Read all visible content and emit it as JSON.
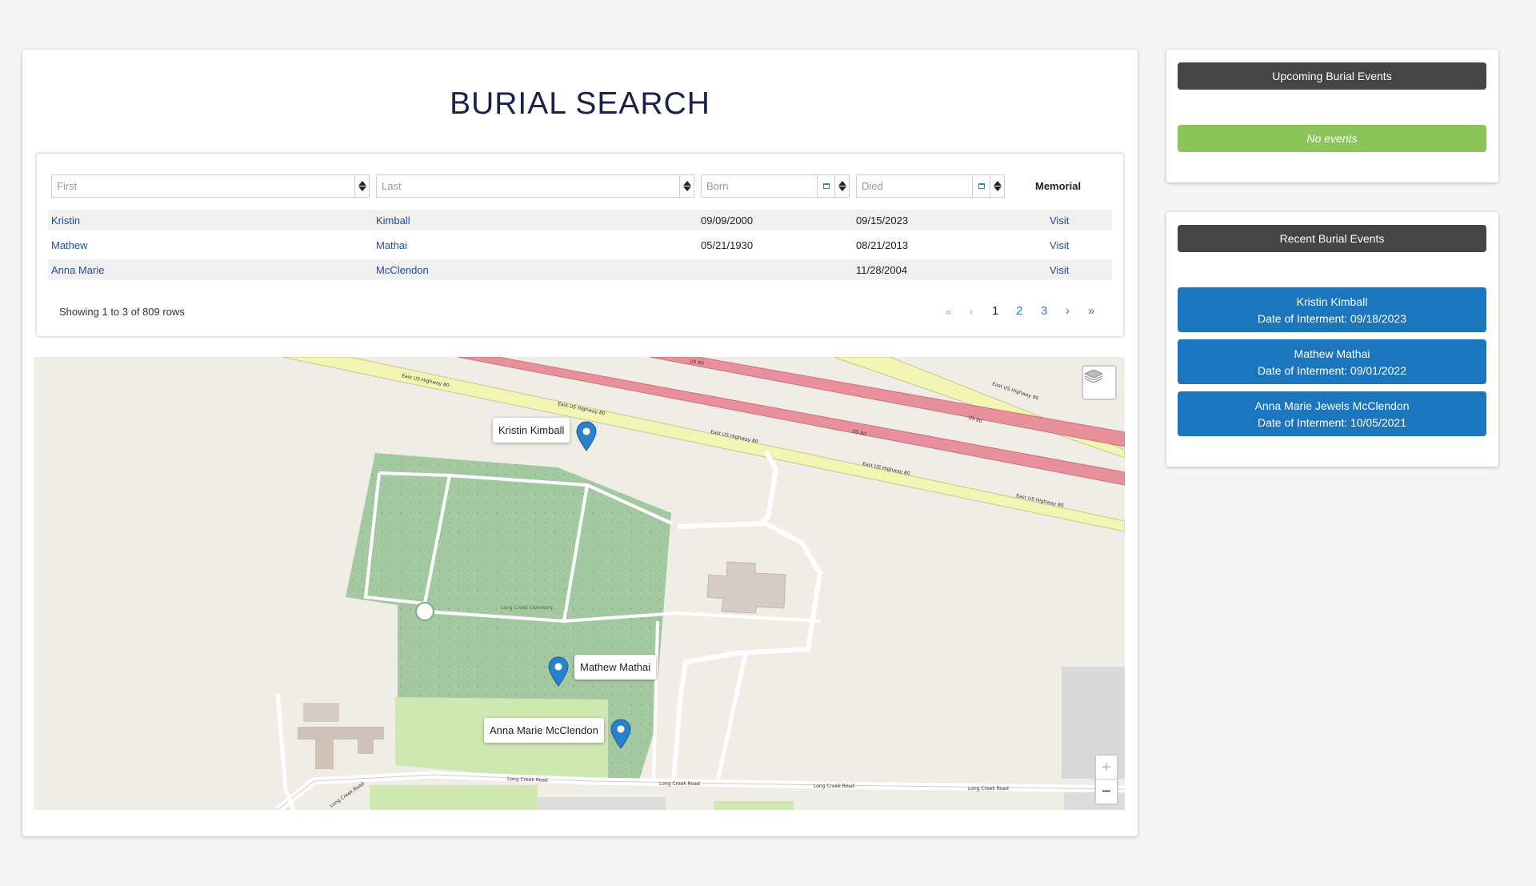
{
  "page": {
    "title": "BURIAL SEARCH"
  },
  "table": {
    "filters": {
      "first": "First",
      "last": "Last",
      "born": "Born",
      "died": "Died"
    },
    "memorial_header": "Memorial",
    "rows": [
      {
        "first": "Kristin",
        "last": "Kimball",
        "born": "09/09/2000",
        "died": "09/15/2023",
        "memorial": "Visit"
      },
      {
        "first": "Mathew",
        "last": "Mathai",
        "born": "05/21/1930",
        "died": "08/21/2013",
        "memorial": "Visit"
      },
      {
        "first": "Anna Marie",
        "last": "McClendon",
        "born": "",
        "died": "11/28/2004",
        "memorial": "Visit"
      }
    ],
    "showing": "Showing 1 to 3 of 809 rows",
    "pagination": {
      "first": "«",
      "prev": "‹",
      "pages": [
        "1",
        "2",
        "3"
      ],
      "current": "1",
      "next": "›",
      "last": "»"
    }
  },
  "map": {
    "markers": [
      {
        "label": "Kristin Kimball"
      },
      {
        "label": "Mathew Mathai"
      },
      {
        "label": "Anna Marie McClendon"
      }
    ],
    "road_labels": {
      "hwy": "East US Highway 80",
      "us80": "US 80",
      "long_creek": "Long Creek Road",
      "cemetery": "Long Creek Cemetery"
    },
    "zoom_in": "+",
    "zoom_out": "−",
    "layers_icon": "layers-icon"
  },
  "upcoming": {
    "title": "Upcoming Burial Events",
    "empty": "No events"
  },
  "recent": {
    "title": "Recent Burial Events",
    "events": [
      {
        "name": "Kristin Kimball",
        "date": "Date of Interment: 09/18/2023"
      },
      {
        "name": "Mathew Mathai",
        "date": "Date of Interment: 09/01/2022"
      },
      {
        "name": "Anna Marie Jewels McClendon",
        "date": "Date of Interment: 10/05/2021"
      }
    ]
  },
  "colors": {
    "accent_blue": "#1b76bd",
    "green_badge": "#8bc55a",
    "header_dark": "#454545",
    "title": "#1a1f4e"
  }
}
